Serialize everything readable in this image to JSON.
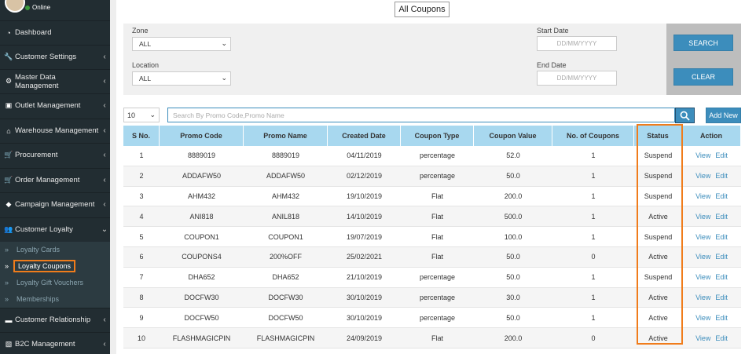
{
  "user": {
    "status": "Online"
  },
  "sidebar": {
    "items": [
      {
        "label": "Dashboard",
        "icon": "dashboard-icon",
        "glyph": "◔",
        "chevron": ""
      },
      {
        "label": "Customer Settings",
        "icon": "wrench-icon",
        "glyph": "🔧",
        "chevron": "‹"
      },
      {
        "label": "Master Data Management",
        "icon": "gear-icon",
        "glyph": "⚙",
        "chevron": "‹"
      },
      {
        "label": "Outlet Management",
        "icon": "store-icon",
        "glyph": "▣",
        "chevron": "‹"
      },
      {
        "label": "Warehouse Management",
        "icon": "home-icon",
        "glyph": "⌂",
        "chevron": "‹"
      },
      {
        "label": "Procurement",
        "icon": "cart-icon",
        "glyph": "🛒",
        "chevron": "‹"
      },
      {
        "label": "Order Management",
        "icon": "cart-icon",
        "glyph": "🛒",
        "chevron": "‹"
      },
      {
        "label": "Campaign Management",
        "icon": "tag-icon",
        "glyph": "◆",
        "chevron": "‹"
      },
      {
        "label": "Customer Loyalty",
        "icon": "users-icon",
        "glyph": "👥",
        "chevron": "⌄"
      }
    ],
    "subitems": [
      {
        "label": "Loyalty Cards"
      },
      {
        "label": "Loyalty Coupons"
      },
      {
        "label": "Loyalty Gift Vouchers"
      },
      {
        "label": "Memberships"
      }
    ],
    "bottom_items": [
      {
        "label": "Customer Relationship",
        "icon": "card-icon",
        "glyph": "▬",
        "chevron": "‹"
      },
      {
        "label": "B2C Management",
        "icon": "image-icon",
        "glyph": "▧",
        "chevron": "‹"
      }
    ]
  },
  "page": {
    "title": "All Coupons"
  },
  "filters": {
    "zone_label": "Zone",
    "zone_value": "ALL",
    "location_label": "Location",
    "location_value": "ALL",
    "start_label": "Start Date",
    "start_placeholder": "DD/MM/YYYY",
    "end_label": "End Date",
    "end_placeholder": "DD/MM/YYYY",
    "search_button": "SEARCH",
    "clear_button": "CLEAR"
  },
  "toolbar": {
    "page_size": "10",
    "search_placeholder": "Search By Promo Code,Promo Name",
    "add_new": "Add New"
  },
  "table": {
    "columns": [
      "S No.",
      "Promo Code",
      "Promo Name",
      "Created Date",
      "Coupon Type",
      "Coupon Value",
      "No. of Coupons",
      "Status",
      "Action"
    ],
    "view_label": "View",
    "edit_label": "Edit",
    "rows": [
      [
        "1",
        "8889019",
        "8889019",
        "04/11/2019",
        "percentage",
        "52.0",
        "1",
        "Suspend"
      ],
      [
        "2",
        "ADDAFW50",
        "ADDAFW50",
        "02/12/2019",
        "percentage",
        "50.0",
        "1",
        "Suspend"
      ],
      [
        "3",
        "AHM432",
        "AHM432",
        "19/10/2019",
        "Flat",
        "200.0",
        "1",
        "Suspend"
      ],
      [
        "4",
        "ANI818",
        "ANIL818",
        "14/10/2019",
        "Flat",
        "500.0",
        "1",
        "Active"
      ],
      [
        "5",
        "COUPON1",
        "COUPON1",
        "19/07/2019",
        "Flat",
        "100.0",
        "1",
        "Suspend"
      ],
      [
        "6",
        "COUPONS4",
        "200%OFF",
        "25/02/2021",
        "Flat",
        "50.0",
        "0",
        "Active"
      ],
      [
        "7",
        "DHA652",
        "DHA652",
        "21/10/2019",
        "percentage",
        "50.0",
        "1",
        "Suspend"
      ],
      [
        "8",
        "DOCFW30",
        "DOCFW30",
        "30/10/2019",
        "percentage",
        "30.0",
        "1",
        "Active"
      ],
      [
        "9",
        "DOCFW50",
        "DOCFW50",
        "30/10/2019",
        "percentage",
        "50.0",
        "1",
        "Active"
      ],
      [
        "10",
        "FLASHMAGICPIN",
        "FLASHMAGICPIN",
        "24/09/2019",
        "Flat",
        "200.0",
        "0",
        "Active"
      ]
    ]
  },
  "colors": {
    "sidebar": "#222d32",
    "accent": "#3c8dbc",
    "header": "#a8d8ef",
    "highlight": "#f07c1b"
  }
}
